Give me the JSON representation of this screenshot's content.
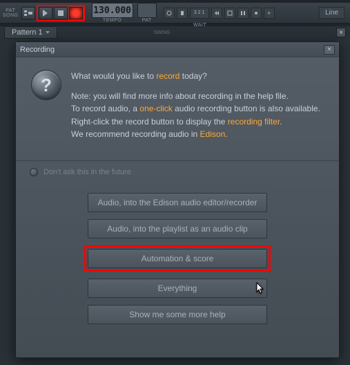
{
  "toolbar": {
    "pat_label": "PAT",
    "song_label": "SONG",
    "tempo_value": "130.000",
    "tempo_label": "TEMPO",
    "mode_line": "Line",
    "wait_label": "WAIT",
    "countdown_label": "3 2 1",
    "icons": [
      "metronome",
      "wait",
      "count",
      "overdub",
      "loop",
      "step",
      "tool",
      "add"
    ]
  },
  "pattern": {
    "tab_label": "Pattern 1",
    "swing_label": "SWING"
  },
  "dialog": {
    "title": "Recording",
    "q1_pre": "What would you like to ",
    "q1_hl": "record",
    "q1_post": " today?",
    "note1": "Note: you will find more info about recording in the help file.",
    "note2_pre": "To record audio, a ",
    "note2_hl": "one-click",
    "note2_post": " audio recording button is also available.",
    "note3_pre": "Right-click the record button to display the ",
    "note3_hl": "recording filter",
    "note3_post": ".",
    "note4_pre": "We recommend recording audio in ",
    "note4_hl": "Edison",
    "note4_post": ".",
    "checkbox_label": "Don't ask this in the future",
    "buttons": {
      "b1": "Audio, into the Edison audio editor/recorder",
      "b2": "Audio, into the playlist as an audio clip",
      "b3": "Automation & score",
      "b4": "Everything",
      "b5": "Show me some more help"
    }
  }
}
